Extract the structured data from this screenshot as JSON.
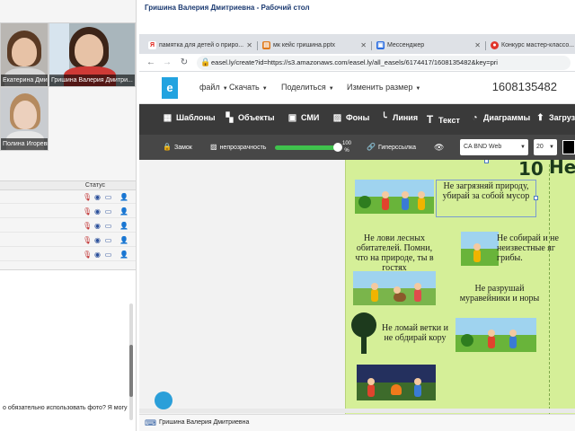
{
  "colors": {
    "accent": "#22a3e0",
    "toolbar_dark": "#3a3a3a",
    "propbar": "#474747",
    "poster_bg": "#d5ef98",
    "slider_green": "#3fc24d"
  },
  "participants": {
    "tiles": [
      {
        "caption": "Екатерина Дми..."
      },
      {
        "caption": "Гришина Валерия  Дмитри..."
      },
      {
        "caption": "Полина Игоревна"
      }
    ],
    "status_label": "Статус",
    "rows": [
      {
        "icons": [
          "mic-off-icon",
          "webcam-icon",
          "screen-icon",
          "user-icon"
        ]
      },
      {
        "icons": [
          "mic-off-icon",
          "webcam-icon",
          "screen-icon",
          "user-icon"
        ]
      },
      {
        "icons": [
          "mic-off-icon",
          "webcam-icon",
          "screen-icon",
          "user-icon"
        ]
      },
      {
        "icons": [
          "mic-off-icon",
          "webcam-icon",
          "screen-icon",
          "user-icon"
        ]
      },
      {
        "icons": [
          "mic-off-icon",
          "webcam-icon",
          "screen-icon",
          "user-icon"
        ]
      }
    ]
  },
  "chat": {
    "message": "о обязательно использовать фото? Я могу"
  },
  "window": {
    "title": "Гришина Валерия  Дмитриевна - Рабочий стол"
  },
  "browser": {
    "tabs": [
      {
        "icon": "yandex-icon",
        "label": "памятка для детей о приро..."
      },
      {
        "icon": "doc-icon",
        "label": "мк кейс гришина.pptx"
      },
      {
        "icon": "messenger-icon",
        "label": "Мессенджер"
      },
      {
        "icon": "chrome-icon",
        "label": "Конкурс мастер-классо..."
      }
    ],
    "url": "easel.ly/create?id=https://s3.amazonaws.com/easel.ly/all_easels/6174417/1608135482&key=pri"
  },
  "easel": {
    "logo": "e",
    "menu": [
      "файл",
      "Скачать",
      "Поделиться",
      "Изменить размер"
    ],
    "doc_id": "1608135482",
    "toolbar": [
      {
        "icon": "templates-icon",
        "label": "Шаблоны"
      },
      {
        "icon": "objects-icon",
        "label": "Объекты"
      },
      {
        "icon": "media-icon",
        "label": "СМИ"
      },
      {
        "icon": "backgrounds-icon",
        "label": "Фоны"
      },
      {
        "icon": "line-icon",
        "label": "Линия"
      },
      {
        "icon": "text-icon",
        "label": "Текст"
      },
      {
        "icon": "charts-icon",
        "label": "Диаграммы"
      },
      {
        "icon": "upload-icon",
        "label": "Загруз"
      }
    ],
    "props": {
      "lock": "Замок",
      "opacity": "непрозрачность",
      "opacity_value": "100 %",
      "opacity_fraction": 1.0,
      "hyperlink": "Гиперссылка",
      "font": "CA BND Web",
      "size": "20",
      "text_color": "#000000"
    }
  },
  "poster": {
    "title_left": "10",
    "title_right": "Не",
    "rules": [
      "Не загрязняй природу, убирай за собой мусор",
      "Не лови лесных обитателей. Помни, что на природе, ты в гостях",
      "Не разрушай муравейники и норы",
      "Не ломай ветки и не обдирай кору",
      "Не собирай и не неизвестные яг грибы."
    ]
  },
  "bottom": {
    "name": "Гришина Валерия  Дмитриевна"
  }
}
